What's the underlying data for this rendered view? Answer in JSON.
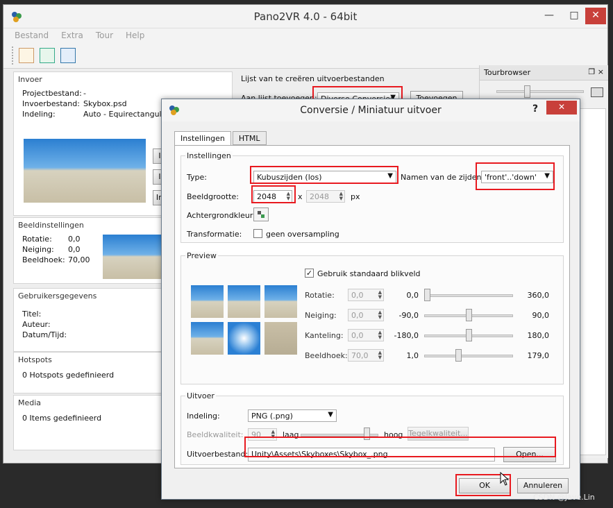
{
  "main": {
    "title": "Pano2VR 4.0 - 64bit",
    "menu": [
      "Bestand",
      "Extra",
      "Tour",
      "Help"
    ],
    "invoer": {
      "heading": "Invoer",
      "rows": [
        {
          "k": "Projectbestand:",
          "v": "-"
        },
        {
          "k": "Invoerbestand:",
          "v": "Skybox.psd"
        },
        {
          "k": "Indeling:",
          "v": "Auto - Equirectangulai"
        }
      ]
    },
    "output_list": {
      "heading": "Lijst van te creëren uitvoerbestanden",
      "add_label": "Aan lijst toevoegen:",
      "add_value": "Diverse Conversies",
      "add_button": "Toevoegen"
    },
    "beeld": {
      "heading": "Beeldinstellingen",
      "rows": [
        {
          "k": "Rotatie:",
          "v": "0,0"
        },
        {
          "k": "Neiging:",
          "v": "0,0"
        },
        {
          "k": "Beeldhoek:",
          "v": "70,00"
        }
      ]
    },
    "gebruiker": {
      "heading": "Gebruikersgegevens",
      "rows": [
        "Titel:",
        "Auteur:",
        "Datum/Tijd:"
      ]
    },
    "hotspots": {
      "heading": "Hotspots",
      "text": "0 Hotspots gedefinieerd"
    },
    "media": {
      "heading": "Media",
      "text": "0 Items gedefinieerd"
    },
    "side_buttons": [
      "I",
      "I",
      "In"
    ],
    "tourbrowser": {
      "title": "Tourbrowser",
      "ctrl": "❐ ×"
    }
  },
  "dialog": {
    "title": "Conversie / Miniatuur uitvoer",
    "help": "?",
    "close": "✕",
    "tabs": [
      "Instellingen",
      "HTML"
    ],
    "instellingen": {
      "heading": "Instellingen",
      "type_label": "Type:",
      "type_value": "Kubuszijden (los)",
      "names_label": "Namen van de zijden:",
      "names_value": "'front'..'down'",
      "size_label": "Beeldgrootte:",
      "size_w": "2048",
      "size_x": "x",
      "size_h": "2048",
      "size_unit": "px",
      "bg_label": "Achtergrondkleur:",
      "transform_label": "Transformatie:",
      "oversampling_label": "geen oversampling"
    },
    "preview": {
      "heading": "Preview",
      "default_fov_label": "Gebruik standaard blikveld",
      "rows": [
        {
          "label": "Rotatie:",
          "spin": "0,0",
          "min": "0,0",
          "max": "360,0",
          "level": 0.0
        },
        {
          "label": "Neiging:",
          "spin": "0,0",
          "min": "-90,0",
          "max": "90,0",
          "level": 0.5
        },
        {
          "label": "Kanteling:",
          "spin": "0,0",
          "min": "-180,0",
          "max": "180,0",
          "level": 0.5
        },
        {
          "label": "Beeldhoek:",
          "spin": "70,0",
          "min": "1,0",
          "max": "179,0",
          "level": 0.38
        }
      ]
    },
    "uitvoer": {
      "heading": "Uitvoer",
      "format_label": "Indeling:",
      "format_value": "PNG (.png)",
      "quality_label": "Beeldkwaliteit:",
      "quality_value": "90",
      "low": "laag",
      "high": "hoog",
      "tile_button": "Tegelkwaliteit...",
      "quality_level": 0.88,
      "file_label": "Uitvoerbestand:",
      "file_value": "Unity\\Assets\\Skyboxes\\Skybox_.png",
      "open_button": "Open..."
    },
    "ok": "OK",
    "cancel": "Annuleren"
  },
  "watermark": "CSDN @Jave.Lin",
  "colors": {
    "highlight": "#e8191f",
    "close": "#c8403a"
  }
}
